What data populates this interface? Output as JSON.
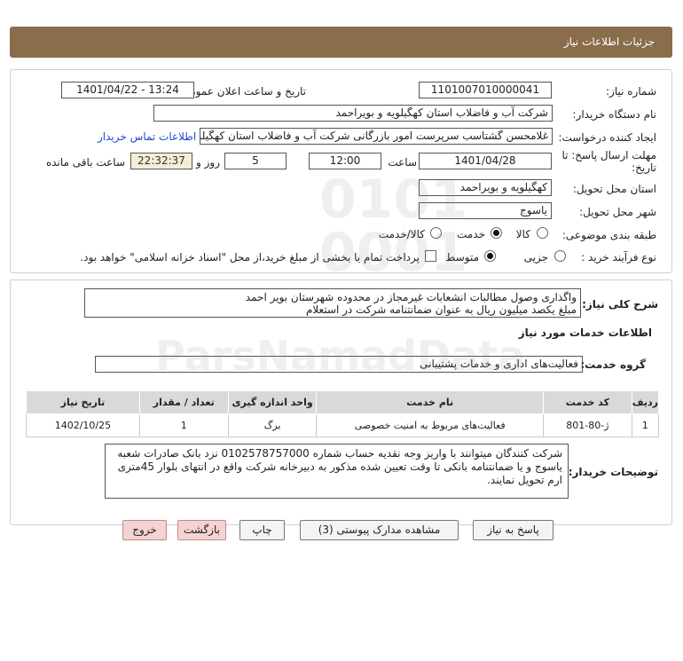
{
  "header": {
    "title": "جزئیات اطلاعات نیاز"
  },
  "fields": {
    "need_number_label": "شماره نیاز:",
    "need_number": "1101007010000041",
    "announce_label": "تاریخ و ساعت اعلان عمومی:",
    "announce_value": "1401/04/22 - 13:24",
    "buyer_org_label": "نام دستگاه خریدار:",
    "buyer_org": "شرکت آب و فاضلاب استان کهگیلویه و بویراحمد",
    "creator_label": "ایجاد کننده درخواست:",
    "creator": "غلامحسن گشتاسب سرپرست امور بازرگانی شرکت آب و فاضلاب استان کهگیلویه و بویراحمد",
    "contact_link": "اطلاعات تماس خریدار",
    "deadline_label_line1": "مهلت ارسال پاسخ: تا",
    "deadline_label_line2": "تاریخ:",
    "deadline_date": "1401/04/28",
    "time_label": "ساعت",
    "deadline_time": "12:00",
    "days_value": "5",
    "days_label": "روز و",
    "remaining_time": "22:32:37",
    "remaining_label": "ساعت باقی مانده",
    "province_label": "استان محل تحویل:",
    "province": "کهگیلویه و بویراحمد",
    "city_label": "شهر محل تحویل:",
    "city": "یاسوج",
    "category_label": "طبقه بندی موضوعی:",
    "category_options": [
      "کالا",
      "خدمت",
      "کالا/خدمت"
    ],
    "process_label": "نوع فرآیند خرید :",
    "process_options": [
      "جزیی",
      "متوسط"
    ],
    "payment_note": "پرداخت تمام یا بخشی از مبلغ خرید،از محل \"اسناد خزانه اسلامی\" خواهد بود."
  },
  "need": {
    "desc_label": "شرح کلی نیاز:",
    "desc_line1": "واگذاری وصول مطالبات انشعابات غیرمجاز در محدوده شهرستان بویر احمد",
    "desc_line2": "مبلغ یکصد میلیون ریال به عنوان ضمانتنامه شرکت در استعلام",
    "services_title": "اطلاعات خدمات مورد نیاز",
    "group_label": "گروه خدمت:",
    "group_value": "فعالیت‌های اداری و خدمات پشتیبانی"
  },
  "table": {
    "headers": [
      "ردیف",
      "کد خدمت",
      "نام خدمت",
      "واحد اندازه گیری",
      "تعداد / مقدار",
      "تاریخ نیاز"
    ],
    "rows": [
      {
        "row": "1",
        "code": "ژ-80-801",
        "name": "فعالیت‌های مربوط به امنیت خصوصی",
        "unit": "برگ",
        "qty": "1",
        "date": "1402/10/25"
      }
    ]
  },
  "buyer_notes": {
    "label": "توضیحات خریدار:",
    "line1": "شرکت کنندگان میتوانند با واریز وجه نقدیه حساب شماره 0102578757000 نزد بانک صادرات شعبه",
    "line2": "یاسوج و یا ضمانتنامه بانکی تا وقت تعیین شده مذکور به  دبیرخانه شرکت واقع در انتهای بلوار 45متری",
    "line3": "ارم  تحویل نمایند."
  },
  "buttons": {
    "reply": "پاسخ به نیاز",
    "attachments": "مشاهده مدارک پیوستی (3)",
    "print": "چاپ",
    "back": "بازگشت",
    "exit": "خروج"
  },
  "colors": {
    "header_bg": "#8a6d4a",
    "link": "#1a4cc8",
    "remaining_bg": "#f2eed7",
    "exit_btn_bg": "#f6d2d2"
  }
}
